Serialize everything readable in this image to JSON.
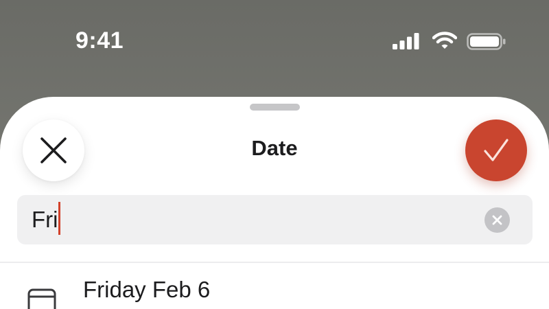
{
  "status_bar": {
    "time": "9:41",
    "icons": [
      "cellular-signal-icon",
      "wifi-icon",
      "battery-icon"
    ],
    "signal_level": 1.0,
    "battery_level": 1.0
  },
  "sheet": {
    "title": "Date",
    "close_icon": "close-icon",
    "confirm_icon": "checkmark-icon",
    "accent_color": "#c9452f"
  },
  "search": {
    "value": "Fri",
    "clear_icon": "clear-icon",
    "cursor_color": "#d2412a"
  },
  "results": [
    {
      "icon": "calendar-icon",
      "label": "Friday Feb 6"
    }
  ]
}
